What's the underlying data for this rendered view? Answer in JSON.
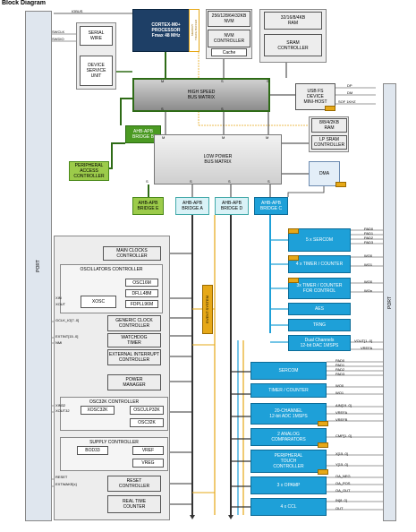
{
  "title": "Block Diagram",
  "core": {
    "cpu": "CORTEX-M0+\nPROCESSOR\nFmax 48 MHz",
    "mtb": "MEMORY\nTRACE BUFFER",
    "iobus": "IOBUS"
  },
  "memory": {
    "nvm": "256/128/64/32KB\nNVM",
    "nvm_ctrl": "NVM\nCONTROLLER",
    "cache": "Cache",
    "ram": "32/16/8/4KB\nRAM",
    "sram_ctrl": "SRAM\nCONTROLLER",
    "lp_ram": "8/8/4/2KB\nRAM",
    "lp_sram_ctrl": "LP SRAM\nCONTROLLER"
  },
  "debug": {
    "serial_wire": "SERIAL\nWIRE",
    "dsu": "DEVICE\nSERVICE\nUNIT",
    "swclk": "SWCLK",
    "swdio": "SWDIO"
  },
  "buses": {
    "hs": "HIGH SPEED\nBUS MATRIX",
    "lp": "LOW POWER\nBUS MATRIX"
  },
  "usb": {
    "label": "USB FS\nDEVICE\nMINI-HOST",
    "dp": "DP",
    "dm": "DM",
    "sof": "SOF 1KHZ"
  },
  "dma": "DMA",
  "pac": "PERIPHERAL\nACCESS\nCONTROLLER",
  "bridges": {
    "b": "AHB-APB\nBRIDGE B",
    "e": "AHB-APB\nBRIDGE E",
    "a": "AHB-APB\nBRIDGE A",
    "d": "AHB-APB\nBRIDGE D",
    "c": "AHB-APB\nBRIDGE C"
  },
  "port": "PORT",
  "event_system": "EVENT SYSTEM",
  "bus_letters": {
    "m": "M",
    "s": "S"
  },
  "left_periph": {
    "main_clocks": "MAIN CLOCKS\nCONTROLLER",
    "osc_ctrl": "OSCILLATORS CONTROLLER",
    "osc16m": "OSC16M",
    "dfll48m": "DFLL48M",
    "fdpll96m": "FDPLL96M",
    "xosc": "XOSC",
    "xin": "XIN",
    "xout": "XOUT",
    "gclk": "GENERIC CLOCK\nCONTROLLER",
    "gclk_sig": "GCLK_IO[7..0]",
    "wdt": "WATCHDOG\nTIMER",
    "eic": "EXTERNAL INTERRUPT\nCONTROLLER",
    "extint": "EXTINT[15..0]",
    "nmi": "NMI",
    "pm": "POWER\nMANAGER",
    "osc32k_ctrl": "OSC32K CONTROLLER",
    "xosc32k": "XOSC32K",
    "osculp32k": "OSCULP32K",
    "osc32k": "OSC32K",
    "xin32": "XIN32",
    "xout32": "XOUT32",
    "supc": "SUPPLY CONTROLLER",
    "bod33": "BOD33",
    "vref": "VREF",
    "vreg": "VREG",
    "rstc": "RESET\nCONTROLLER",
    "reset": "RESET",
    "extwake": "EXTWAKE[x]",
    "rtc": "REAL TIME\nCOUNTER"
  },
  "right_c": {
    "sercom5": "5 x SERCOM",
    "tc4": "4 x TIMER / COUNTER",
    "tcc3": "3x TIMER / COUNTER\nFOR CONTROL",
    "aes": "AES",
    "trng": "TRNG",
    "dac": "Dual Channels\n12-bit DAC 1MSPS"
  },
  "right_d": {
    "sercom": "SERCOM",
    "tc": "TIMER / COUNTER",
    "adc": "20-CHANNEL\n12-bit ADC 1MSPS",
    "ac": "2 ANALOG\nCOMPARATORS",
    "ptc": "PERIPHERAL\nTOUCH\nCONTROLLER",
    "opamp": "3 x OPAMP",
    "ccl": "4 x CCL"
  },
  "signals": {
    "pad0": "PAD0",
    "pad1": "PAD1",
    "pad2": "PAD2",
    "pad3": "PAD3",
    "wo0": "WO0",
    "wo1": "WO1",
    "woh": "WOn",
    "vout": "VOUT[1..0]",
    "vrefa": "VREFA",
    "ain": "AIN[19..0]",
    "vrefb": "VREFB",
    "cmp": "CMP[1..0]",
    "xy_x": "X[15..0]",
    "xy_y": "Y[15..0]",
    "oa_neg": "OA_NEG",
    "oa_pos": "OA_POS",
    "oa_out": "OA_OUT",
    "in": "IN[8..0]",
    "out": "OUT"
  },
  "colors": {
    "cyan": "#1ea0d8",
    "green": "#4b9a23",
    "navy": "#1e3f66",
    "orange": "#e6a817"
  }
}
